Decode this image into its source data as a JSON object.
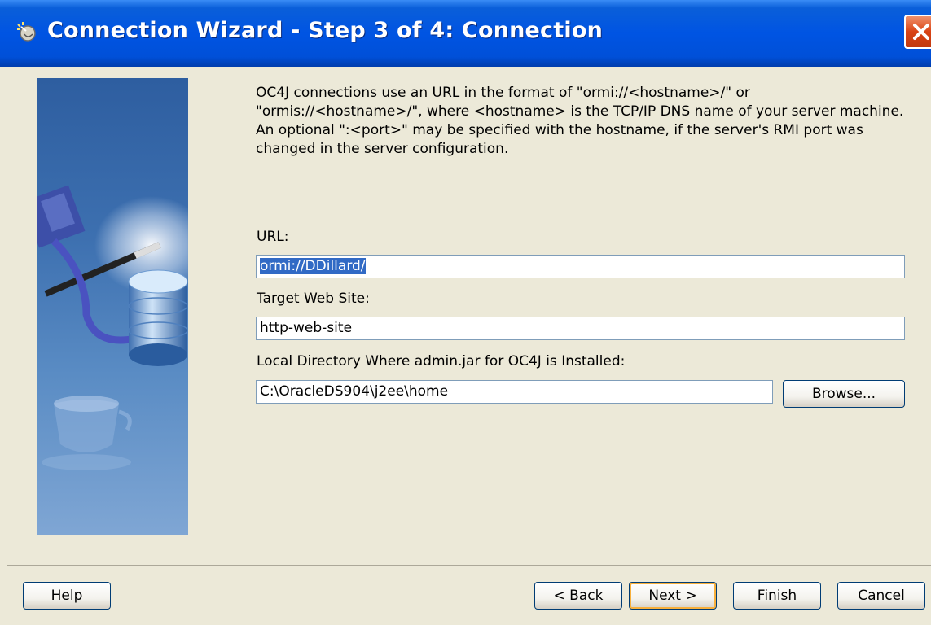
{
  "window": {
    "title": "Connection Wizard - Step 3 of 4: Connection"
  },
  "icons": {
    "title_icon": "wizard-icon",
    "close_icon": "close-icon"
  },
  "description": "OC4J connections use an URL in the format of \"ormi://<hostname>/\" or \"ormis://<hostname>/\", where <hostname> is the TCP/IP DNS name of your server machine.  An optional \":<port>\" may be specified with the hostname, if the server's RMI port was changed in the server configuration.",
  "form": {
    "url_label": "URL:",
    "url_value": "ormi://DDillard/",
    "site_label": "Target Web Site:",
    "site_value": "http-web-site",
    "dir_label": "Local Directory Where admin.jar for OC4J is Installed:",
    "dir_value": "C:\\OracleDS904\\j2ee\\home",
    "browse_label": "Browse..."
  },
  "buttons": {
    "help": "Help",
    "back": "< Back",
    "next": "Next >",
    "finish": "Finish",
    "cancel": "Cancel"
  },
  "colors": {
    "titlebar": "#0054e3",
    "close": "#d94315",
    "selection": "#316ac5",
    "dialog_bg": "#ece9d8"
  }
}
